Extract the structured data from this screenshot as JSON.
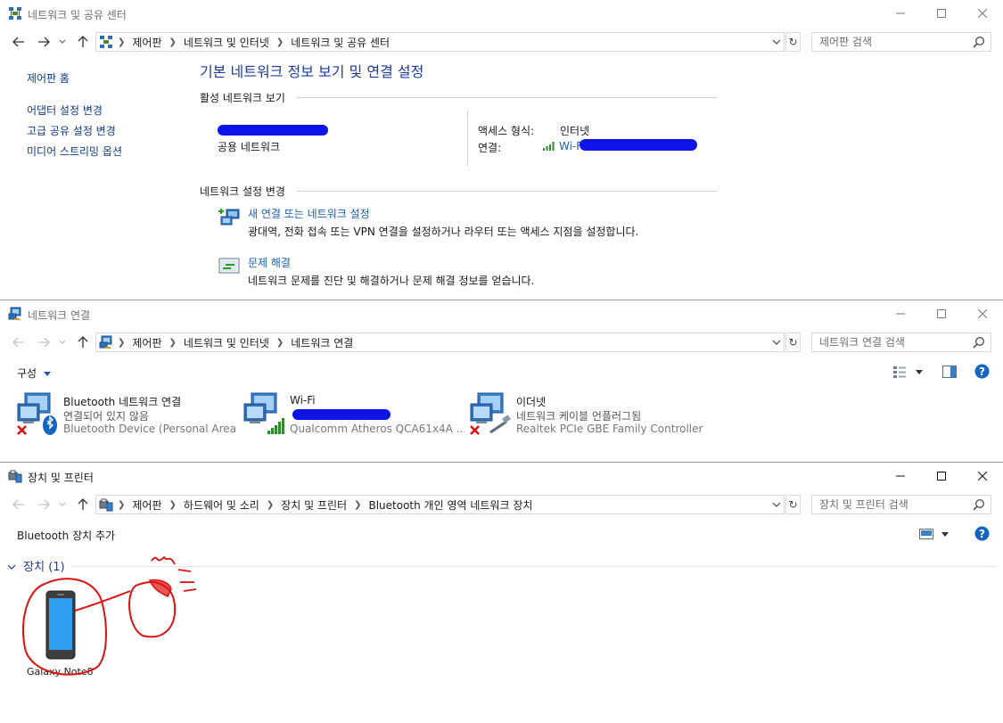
{
  "window_nsc": {
    "title": "네트워크 및 공유 센터",
    "breadcrumbs": [
      "제어판",
      "네트워크 및 인터넷",
      "네트워크 및 공유 센터"
    ],
    "search_placeholder": "제어판 검색",
    "left_links": [
      "제어판 홈",
      "어댑터 설정 변경",
      "고급 공유 설정 변경",
      "미디어 스트리밍 옵션"
    ],
    "heading": "기본 네트워크 정보 보기 및 연결 설정",
    "active_section": "활성 네트워크 보기",
    "network_type": "공용 네트워크",
    "access_type_label": "액세스 형식:",
    "access_type_value": "인터넷",
    "connection_label": "연결:",
    "connection_value": "Wi-Fi",
    "change_section": "네트워크 설정 변경",
    "tasks": [
      {
        "title": "새 연결 또는 네트워크 설정",
        "desc": "광대역, 전화 접속 또는 VPN 연결을 설정하거나 라우터 또는 액세스 지점을 설정합니다."
      },
      {
        "title": "문제 해결",
        "desc": "네트워크 문제를 진단 및 해결하거나 문제 해결 정보를 얻습니다."
      }
    ]
  },
  "window_nc": {
    "title": "네트워크 연결",
    "breadcrumbs": [
      "제어판",
      "네트워크 및 인터넷",
      "네트워크 연결"
    ],
    "search_placeholder": "네트워크 연결 검색",
    "organize_label": "구성",
    "adapters": [
      {
        "name": "Bluetooth 네트워크 연결",
        "status": "연결되어 있지 않음",
        "device": "Bluetooth Device (Personal Area ..."
      },
      {
        "name": "Wi-Fi",
        "status": "",
        "device": "Qualcomm Atheros QCA61x4A ..."
      },
      {
        "name": "이더넷",
        "status": "네트워크 케이블 언플러그됨",
        "device": "Realtek PCIe GBE Family Controller"
      }
    ]
  },
  "window_dp": {
    "title": "장치 및 프린터",
    "breadcrumbs": [
      "제어판",
      "하드웨어 및 소리",
      "장치 및 프린터",
      "Bluetooth 개인 영역 네트워크 장치"
    ],
    "search_placeholder": "장치 및 프린터 검색",
    "add_device_label": "Bluetooth 장치 추가",
    "group_header": "장치 (1)",
    "devices": [
      {
        "name": "Galaxy Note8"
      }
    ]
  },
  "colors": {
    "link": "#1a5fb4",
    "heading": "#1e3a9e",
    "redaction": "#0d14e8",
    "annotation": "#e01010",
    "help": "#1565c0"
  }
}
